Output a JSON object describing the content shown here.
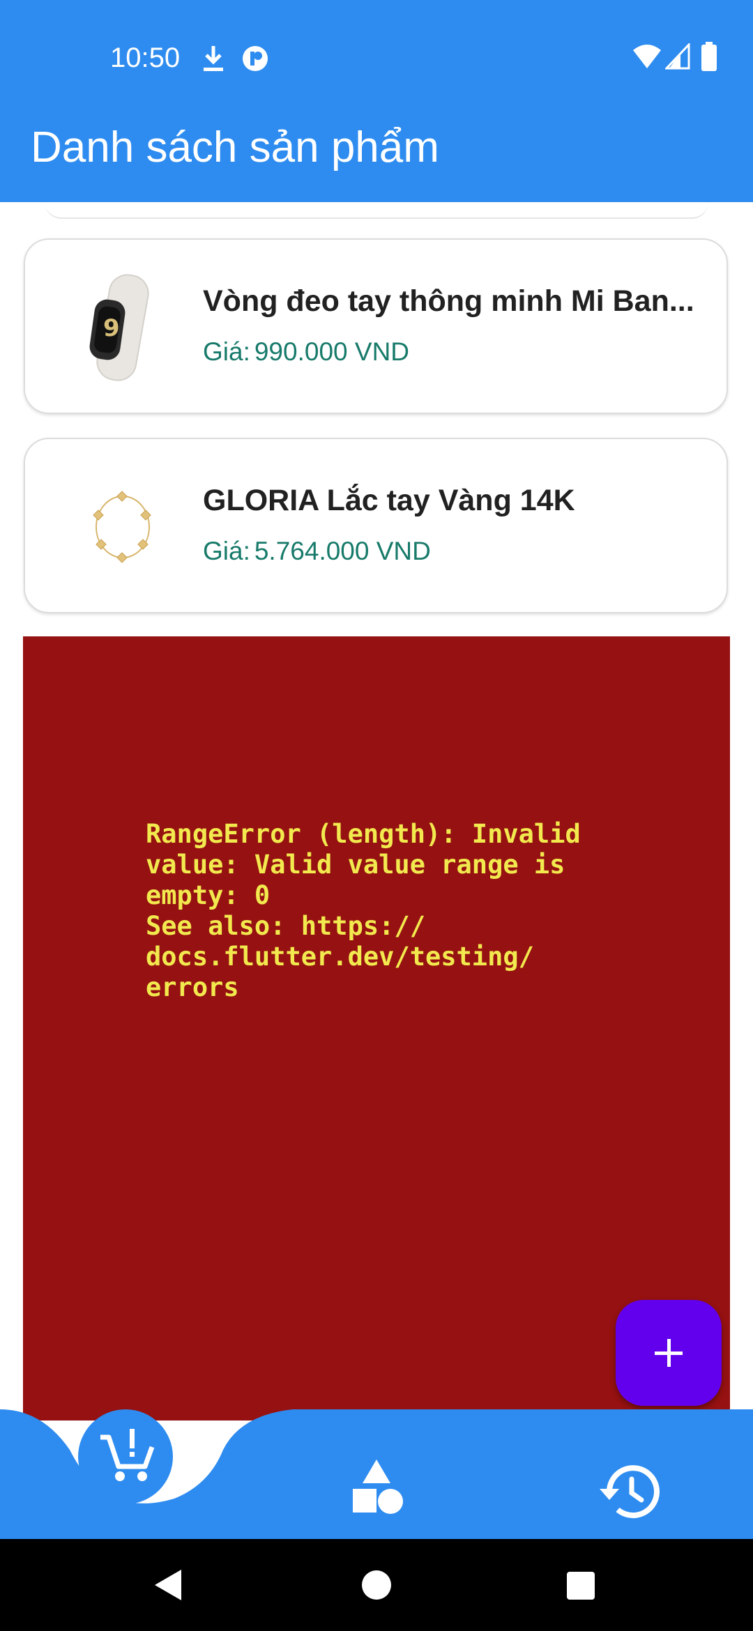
{
  "status_bar": {
    "time": "10:50",
    "icons": [
      "download-icon",
      "app-notification-icon",
      "wifi-icon",
      "signal-icon",
      "battery-icon"
    ]
  },
  "app_bar": {
    "title": "Danh sách sản phẩm"
  },
  "products": [
    {
      "name": "Vòng đeo tay thông minh Mi Ban...",
      "price_label": "Giá:",
      "price_value": "990.000  VND",
      "image": "smart-band-image"
    },
    {
      "name": "GLORIA Lắc tay Vàng 14K",
      "price_label": "Giá:",
      "price_value": "5.764.000  VND",
      "image": "gold-bracelet-image"
    }
  ],
  "error": {
    "message": "RangeError (length): Invalid\nvalue: Valid value range is\nempty: 0\nSee also: https://\ndocs.flutter.dev/testing/\nerrors"
  },
  "fab": {
    "icon": "plus-icon"
  },
  "bottom_nav": {
    "items": [
      {
        "icon": "cart-icon",
        "active": true
      },
      {
        "icon": "shapes-icon",
        "active": false
      },
      {
        "icon": "history-icon",
        "active": false
      }
    ]
  },
  "system_nav": {
    "icons": [
      "back-icon",
      "home-icon",
      "recents-icon"
    ]
  },
  "colors": {
    "primary": "#2e8cf0",
    "price": "#177a6a",
    "error_bg": "#961111",
    "error_text": "#f2e94e",
    "fab": "#6200ee"
  }
}
